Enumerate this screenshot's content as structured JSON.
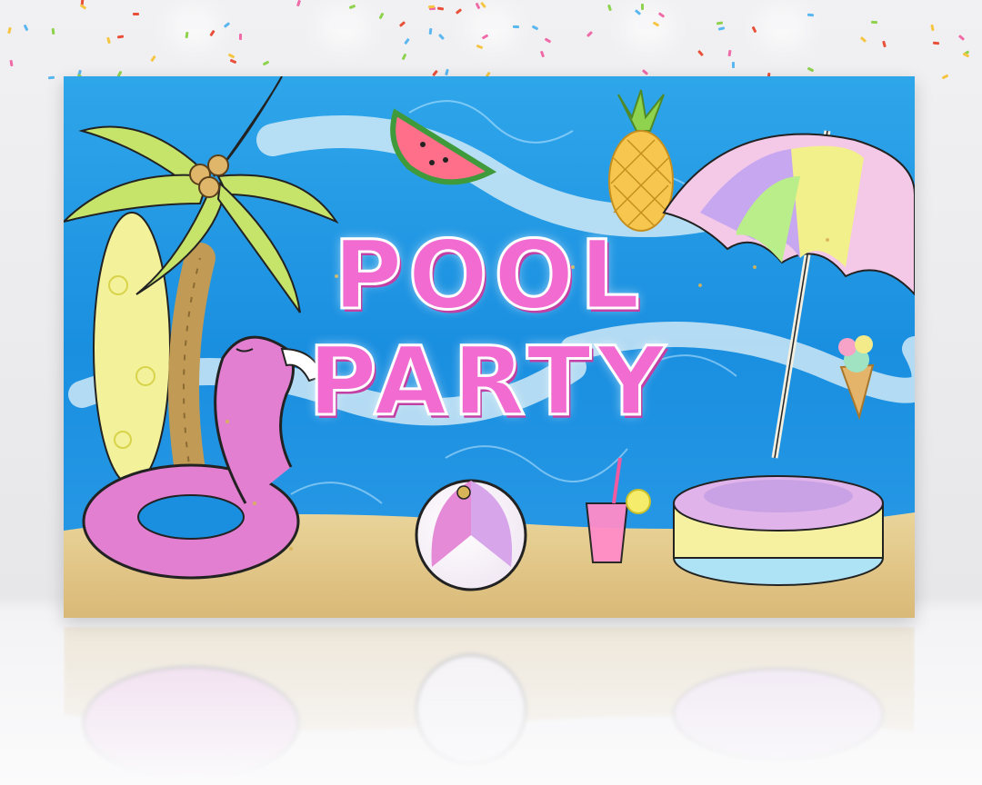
{
  "banner": {
    "title_line1": "POOL",
    "title_line2": "PARTY"
  },
  "colors": {
    "water": "#1a8fe0",
    "sand": "#e6c98a",
    "title_pink": "#f26bd0",
    "flamingo_pink": "#e27fd0",
    "palm_green": "#c6e36a",
    "glitter_gold": "#d8b458"
  },
  "icons": [
    "palm-tree-icon",
    "surfboard-icon",
    "flamingo-float-icon",
    "watermelon-icon",
    "pineapple-icon",
    "beach-umbrella-icon",
    "ice-cream-icon",
    "beach-ball-icon",
    "lemonade-icon",
    "inflatable-pool-icon"
  ]
}
